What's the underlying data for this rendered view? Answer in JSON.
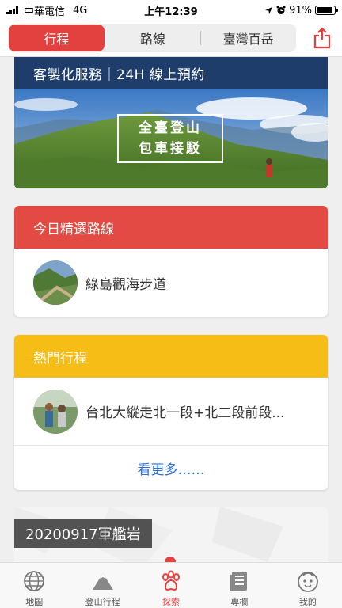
{
  "status_bar": {
    "carrier": "中華電信",
    "network": "4G",
    "time": "上午12:39",
    "battery": "91%",
    "battery_level": 0.91
  },
  "top_nav": {
    "tabs": [
      {
        "label": "行程",
        "active": true
      },
      {
        "label": "路線",
        "active": false
      },
      {
        "label": "臺灣百岳",
        "active": false
      }
    ],
    "share_icon": "share-icon"
  },
  "banner": {
    "title": "客製化服務｜24H 線上預約",
    "line1": "全臺登山",
    "line2": "包車接駁"
  },
  "featured_route": {
    "header": "今日精選路線",
    "items": [
      {
        "label": "綠島觀海步道"
      }
    ]
  },
  "popular_trips": {
    "header": "熱門行程",
    "items": [
      {
        "label": "台北大縱走北一段+北二段前段..."
      }
    ],
    "more": "看更多……"
  },
  "diary": {
    "title": "20200917軍艦岩"
  },
  "tab_bar": {
    "items": [
      {
        "label": "地圖",
        "icon": "globe-icon"
      },
      {
        "label": "登山行程",
        "icon": "mountain-icon"
      },
      {
        "label": "探索",
        "icon": "paw-icon",
        "active": true
      },
      {
        "label": "專欄",
        "icon": "article-icon"
      },
      {
        "label": "我的",
        "icon": "face-icon"
      }
    ]
  },
  "colors": {
    "accent_red": "#e34040",
    "header_red": "#e24a43",
    "header_yellow": "#f6bd16",
    "banner_navy": "#1e3d6b",
    "link_blue": "#2f6fd0"
  }
}
